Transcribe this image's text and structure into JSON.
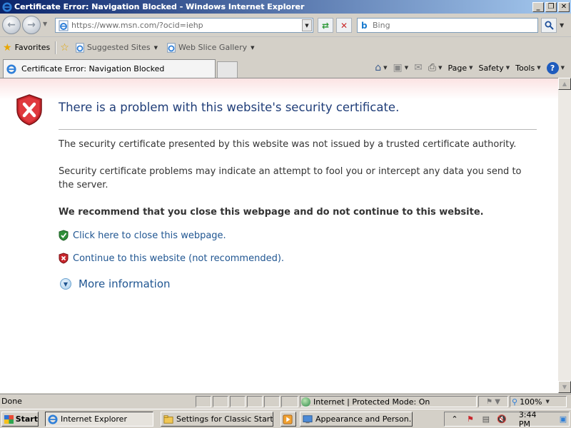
{
  "window": {
    "title": "Certificate Error: Navigation Blocked - Windows Internet Explorer",
    "minimize": "_",
    "maximize": "❐",
    "close": "✕"
  },
  "nav": {
    "url": "https://www.msn.com/?ocid=iehp",
    "search_placeholder": "Bing"
  },
  "favorites": {
    "favorites_label": "Favorites",
    "suggested_sites": "Suggested Sites",
    "web_slice_gallery": "Web Slice Gallery"
  },
  "tab": {
    "title": "Certificate Error: Navigation Blocked"
  },
  "commands": {
    "page": "Page",
    "safety": "Safety",
    "tools": "Tools",
    "help": "?"
  },
  "content": {
    "heading": "There is a problem with this website's security certificate.",
    "para1": "The security certificate presented by this website was not issued by a trusted certificate authority.",
    "para2": "Security certificate problems may indicate an attempt to fool you or intercept any data you send to the server.",
    "recommend": "We recommend that you close this webpage and do not continue to this website.",
    "close_link": "Click here to close this webpage.",
    "continue_link": "Continue to this website (not recommended).",
    "more_info": "More information"
  },
  "status": {
    "text": "Done",
    "zone": "Internet | Protected Mode: On",
    "zoom": "100%"
  },
  "taskbar": {
    "start": "Start",
    "tasks": [
      "Internet Explorer",
      "Settings for Classic Start...",
      "Appearance and Person..."
    ],
    "clock": "3:44 PM"
  },
  "colors": {
    "heading": "#1f3d78",
    "link": "#1f5591",
    "title_bar_start": "#0a246a",
    "title_bar_end": "#a6caf0",
    "shield_red": "#c8262c"
  }
}
